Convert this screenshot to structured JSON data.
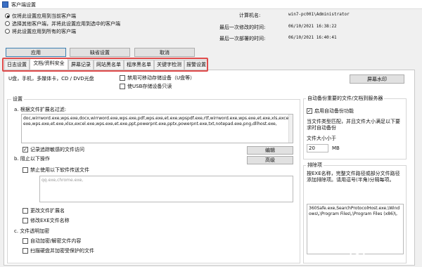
{
  "window": {
    "title": "客户端设置"
  },
  "apply_scope": {
    "options": [
      {
        "label": "仅将此设置应用到当前客户端",
        "selected": true
      },
      {
        "label": "选择其他客户端，并将此设置应用到选中的客户端",
        "selected": false
      },
      {
        "label": "将此设置应用到所有的客户端",
        "selected": false
      }
    ]
  },
  "info": {
    "computer_label": "计算机名:",
    "computer_value": "win7-pc001\\Administrator",
    "modified_label": "最后一次修改的时间:",
    "modified_value": "06/10/2021 16:38:22",
    "deployed_label": "最后一次部署的时间:",
    "deployed_value": "06/10/2021 16:40:41"
  },
  "actions": {
    "apply": "应用",
    "default": "缺省设置",
    "cancel": "取消"
  },
  "tabs": [
    "日志设置",
    "文档/资料安全",
    "屏幕记录",
    "网站黑名单",
    "程序黑名单",
    "关键字检测",
    "报警设置"
  ],
  "top": {
    "usb_line": "U盘，手机，多媒体卡，CD / DVD光盘",
    "disable_mobile": "禁用可移动存储设备（U盘等）",
    "usb_readonly": "使USB存储设备只读",
    "watermark_button": "屏幕水印"
  },
  "settings": {
    "group_title": "设置",
    "a_label": "a. 根据文件扩展名过滤:",
    "ext_list": "doc,wirrword.exe,wps.exe,docx,wirrword.exe,wps.exe,pdf,wps.exe,et.exe,wpspdf.exe,rtf,wirrword.exe,wps.exe,et.exe,xls,excel.exe,wps.exe,et.exe,xlsx,excel.exe,wps.exe,et.exe,ppt,powerpnt.exe,pptx,powerpnt.exe,txt,notepad.exe,png,dllhost.exe,",
    "record_label": "记录追踪敏感的文件访问",
    "b_label": "b. 阻止以下操作",
    "block_software": "禁止使用以下软件传送文件",
    "software_list": "qq.exe,chrome.exe,",
    "change_ext": "更改文件扩展名",
    "modify_exe": "修改EXE文件名称",
    "c_label": "c. 文件透明加密",
    "auto_encrypt": "自动加密/解密文件内容",
    "scan_disk": "扫描硬盘并加密受保护的文件",
    "edit_button": "编辑",
    "advanced_button": "高级"
  },
  "backup": {
    "group_title": "自动备份重要的文件/文档到服务器",
    "enable": "启用自动备份功能",
    "note": "当文件类型匹配，并且文件大小满足以下要求时自动备份",
    "size_label": "文件大小小于",
    "size_value": "20",
    "size_unit": "MB"
  },
  "exclude": {
    "group_title": "排除项",
    "note": "按EXE名称，完整文件路径或部分文件路径添加排除项。请用逗号(半角)分隔每项。",
    "list": "360Safe.exe,SearchProtocolHost.exe,\\Windows\\,\\Program Files\\,\\Program Files (x86)\\,"
  },
  "watermark": {
    "text": "路由器",
    "sub": "luyouqi.com"
  },
  "colors": {
    "highlight": "#e04b4b",
    "selection_blue": "#3c7fb1"
  }
}
